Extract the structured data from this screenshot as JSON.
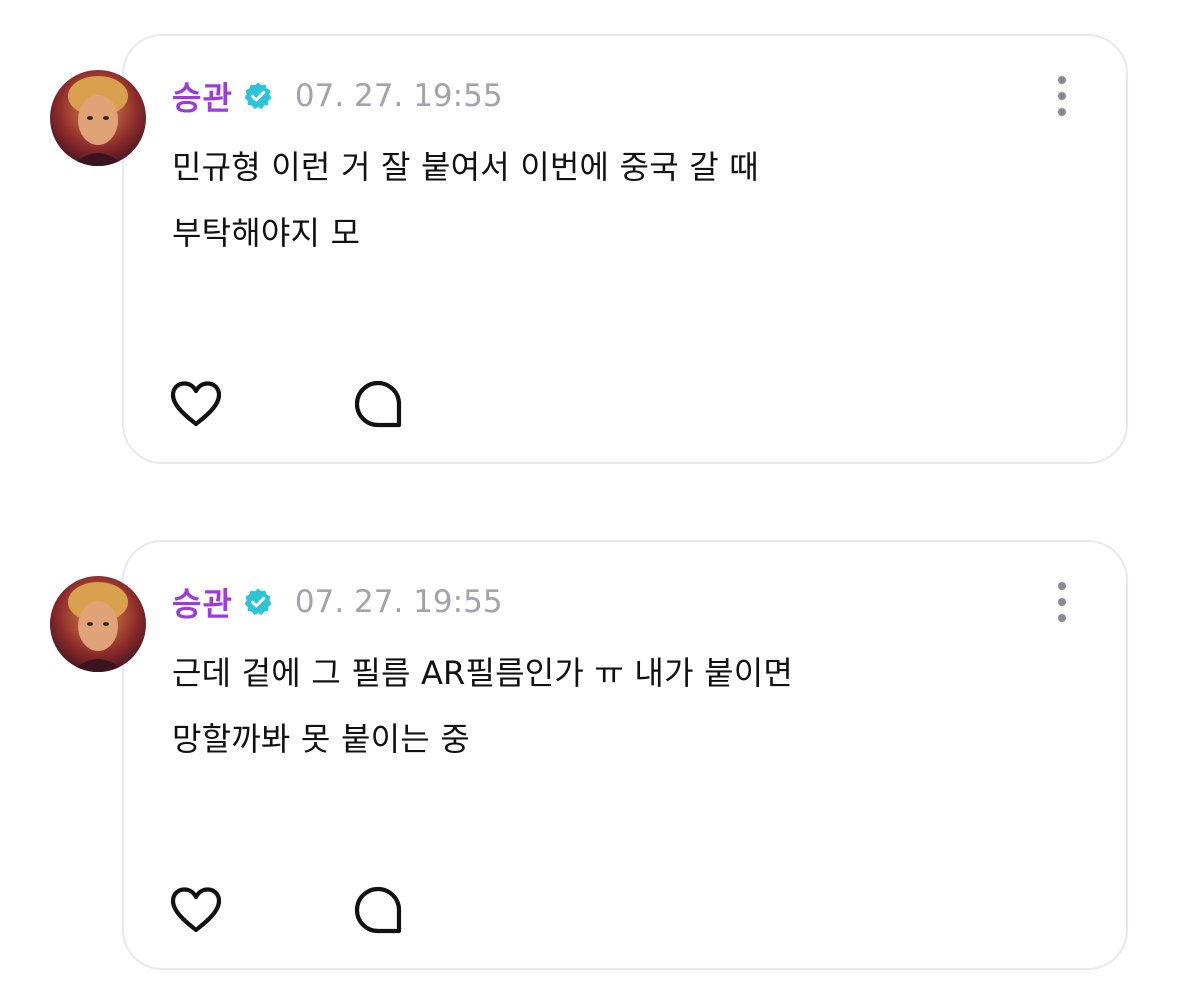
{
  "posts": [
    {
      "author": "승관",
      "timestamp": "07. 27. 19:55",
      "text": "민규형 이런 거 잘 붙여서 이번에 중국 갈 때\n부탁해야지 모"
    },
    {
      "author": "승관",
      "timestamp": "07. 27. 19:55",
      "text": "근데 겉에 그 필름 AR필름인가 ㅠ 내가 붙이면\n망할까봐 못 붙이는 중"
    }
  ],
  "icons": {
    "verified": "verified-badge-icon",
    "more": "more-vertical-icon",
    "like": "heart-icon",
    "comment": "comment-bubble-icon"
  },
  "colors": {
    "author_name": "#9c3ae2",
    "verified_badge": "#2cc5d8",
    "timestamp": "#a3a3ad",
    "card_border": "#e8e8ee",
    "text": "#111111"
  }
}
